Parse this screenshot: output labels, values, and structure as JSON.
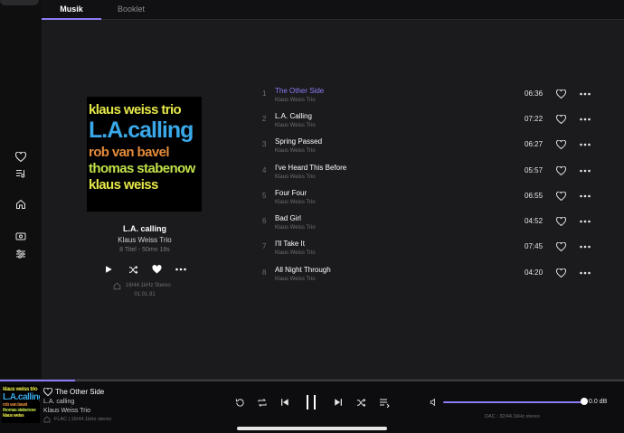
{
  "tabs": [
    {
      "label": "Musik",
      "active": true
    },
    {
      "label": "Booklet",
      "active": false
    }
  ],
  "sidebar": {
    "icons": [
      "heart-icon",
      "music-list-icon",
      "home-icon",
      "radio-icon",
      "equalizer-icon"
    ]
  },
  "album": {
    "cover_lines": [
      "klaus weiss trio",
      "L.A.calling",
      "rob van bavel",
      "thomas stabenow",
      "klaus weiss"
    ],
    "title": "L.A. calling",
    "artist": "Klaus Weiss Trio",
    "meta": "8 Titel - 50mn 18s",
    "quality": "16/44.1kHz Stereo",
    "date": "01.01.91"
  },
  "tracks": [
    {
      "num": "1",
      "title": "The Other Side",
      "artist": "Klaus Weiss Trio",
      "duration": "06:36",
      "playing": true
    },
    {
      "num": "2",
      "title": "L.A. Calling",
      "artist": "Klaus Weiss Trio",
      "duration": "07:22",
      "playing": false
    },
    {
      "num": "3",
      "title": "Spring Passed",
      "artist": "Klaus Weiss Trio",
      "duration": "06:27",
      "playing": false
    },
    {
      "num": "4",
      "title": "I've Heard This Before",
      "artist": "Klaus Weiss Trio",
      "duration": "05:57",
      "playing": false
    },
    {
      "num": "5",
      "title": "Four Four",
      "artist": "Klaus Weiss Trio",
      "duration": "06:55",
      "playing": false
    },
    {
      "num": "6",
      "title": "Bad Girl",
      "artist": "Klaus Weiss Trio",
      "duration": "04:52",
      "playing": false
    },
    {
      "num": "7",
      "title": "I'll Take It",
      "artist": "Klaus Weiss Trio",
      "duration": "07:45",
      "playing": false
    },
    {
      "num": "8",
      "title": "All Night Through",
      "artist": "Klaus Weiss Trio",
      "duration": "04:20",
      "playing": false
    }
  ],
  "player": {
    "title": "The Other Side",
    "album": "L.A. calling",
    "artist": "Klaus Weiss Trio",
    "quality": "FLAC | 16/44.1kHz stereo",
    "progress_fraction": 0.12,
    "volume_fraction": 0.98,
    "volume_label": "0.0 dB",
    "dac_label": "DAC : 32/44.1kHz stereo"
  },
  "colors": {
    "accent": "#8a7cf5",
    "background": "#1b1b1e"
  }
}
